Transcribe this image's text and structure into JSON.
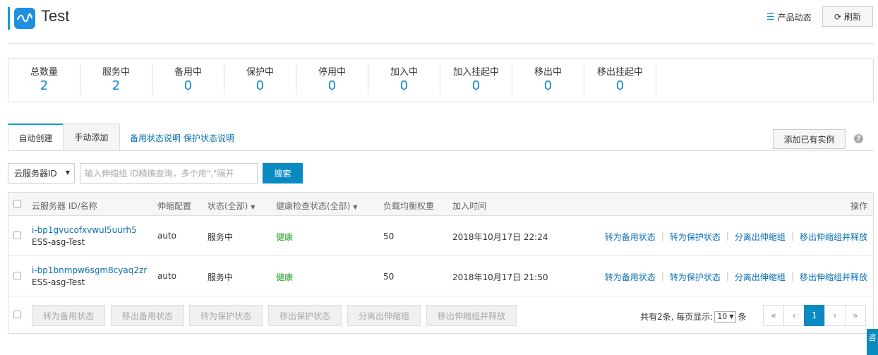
{
  "header": {
    "title": "Test",
    "news_label": "产品动态",
    "refresh_label": "刷新"
  },
  "stats": [
    {
      "label": "总数量",
      "value": "2"
    },
    {
      "label": "服务中",
      "value": "2"
    },
    {
      "label": "备用中",
      "value": "0"
    },
    {
      "label": "保护中",
      "value": "0"
    },
    {
      "label": "停用中",
      "value": "0"
    },
    {
      "label": "加入中",
      "value": "0"
    },
    {
      "label": "加入挂起中",
      "value": "0"
    },
    {
      "label": "移出中",
      "value": "0"
    },
    {
      "label": "移出挂起中",
      "value": "0"
    }
  ],
  "tabs": {
    "auto": "自动创建",
    "manual": "手动添加",
    "standby_help": "备用状态说明",
    "protect_help": "保护状态说明",
    "add_existing": "添加已有实例",
    "help_icon": "?"
  },
  "search": {
    "select_value": "云服务器ID",
    "placeholder": "输入伸缩组 ID精确查询，多个用\",\"隔开",
    "button": "搜索"
  },
  "table": {
    "columns": {
      "id": "云服务器 ID/名称",
      "config": "伸缩配置",
      "status": "状态(全部)",
      "health": "健康检查状态(全部)",
      "weight": "负载均衡权重",
      "time": "加入时间",
      "ops": "操作"
    },
    "rows": [
      {
        "id": "i-bp1gvucofxvwul5uurh5",
        "name": "ESS-asg-Test",
        "config": "auto",
        "status": "服务中",
        "health": "健康",
        "weight": "50",
        "time": "2018年10月17日 22:24"
      },
      {
        "id": "i-bp1bnmpw6sgm8cyaq2zr",
        "name": "ESS-asg-Test",
        "config": "auto",
        "status": "服务中",
        "health": "健康",
        "weight": "50",
        "time": "2018年10月17日 21:50"
      }
    ],
    "row_ops": [
      "转为备用状态",
      "转为保护状态",
      "分离出伸缩组",
      "移出伸缩组并释放"
    ],
    "bulk_buttons": [
      "转为备用状态",
      "移出备用状态",
      "转为保护状态",
      "移出保护状态",
      "分离出伸缩组",
      "移出伸缩组并释放"
    ]
  },
  "pagination": {
    "total_text": "共有2条, 每页显示:",
    "page_size": "10",
    "unit": "条",
    "first": "«",
    "prev": "‹",
    "current": "1",
    "next": "›",
    "last": "»"
  },
  "side_tab": "咨"
}
